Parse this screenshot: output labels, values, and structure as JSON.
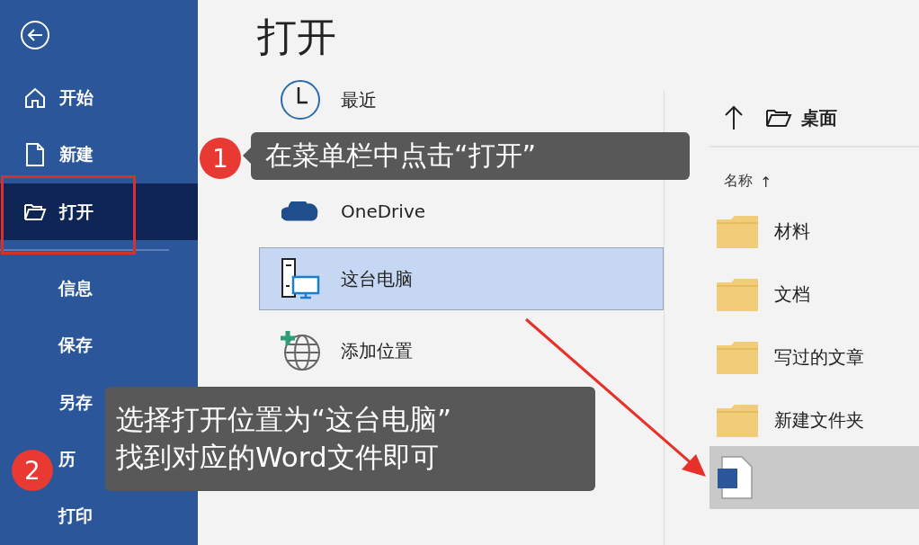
{
  "sidebar": {
    "items": [
      {
        "label": "开始",
        "kind": "home",
        "selected": false
      },
      {
        "label": "新建",
        "kind": "new",
        "selected": false
      },
      {
        "label": "打开",
        "kind": "open",
        "selected": true
      },
      {
        "label": "信息",
        "kind": "plain",
        "selected": false
      },
      {
        "label": "保存",
        "kind": "plain",
        "selected": false
      },
      {
        "label": "另存",
        "kind": "plain",
        "selected": false
      },
      {
        "label": "历",
        "kind": "plain",
        "selected": false
      },
      {
        "label": "打印",
        "kind": "plain",
        "selected": false
      }
    ]
  },
  "page_title": "打开",
  "locations": [
    {
      "label": "最近",
      "kind": "recent",
      "selected": false
    },
    {
      "label": "OneDrive",
      "kind": "cloud",
      "selected": false
    },
    {
      "label": "这台电脑",
      "kind": "computer",
      "selected": true
    },
    {
      "label": "添加位置",
      "kind": "add",
      "selected": false
    }
  ],
  "browser": {
    "path": "桌面",
    "sort_label": "名称",
    "sort_arrow": "↑",
    "items": [
      {
        "name": "材料",
        "kind": "folder"
      },
      {
        "name": "文档",
        "kind": "folder"
      },
      {
        "name": "写过的文章",
        "kind": "folder"
      },
      {
        "name": "新建文件夹",
        "kind": "folder"
      },
      {
        "kind": "word-file"
      }
    ]
  },
  "annotations": [
    {
      "number": "1",
      "text": "在菜单栏中点击“打开”"
    },
    {
      "number": "2",
      "text": "选择打开位置为“这台电脑”\n找到对应的Word文件即可"
    }
  ]
}
